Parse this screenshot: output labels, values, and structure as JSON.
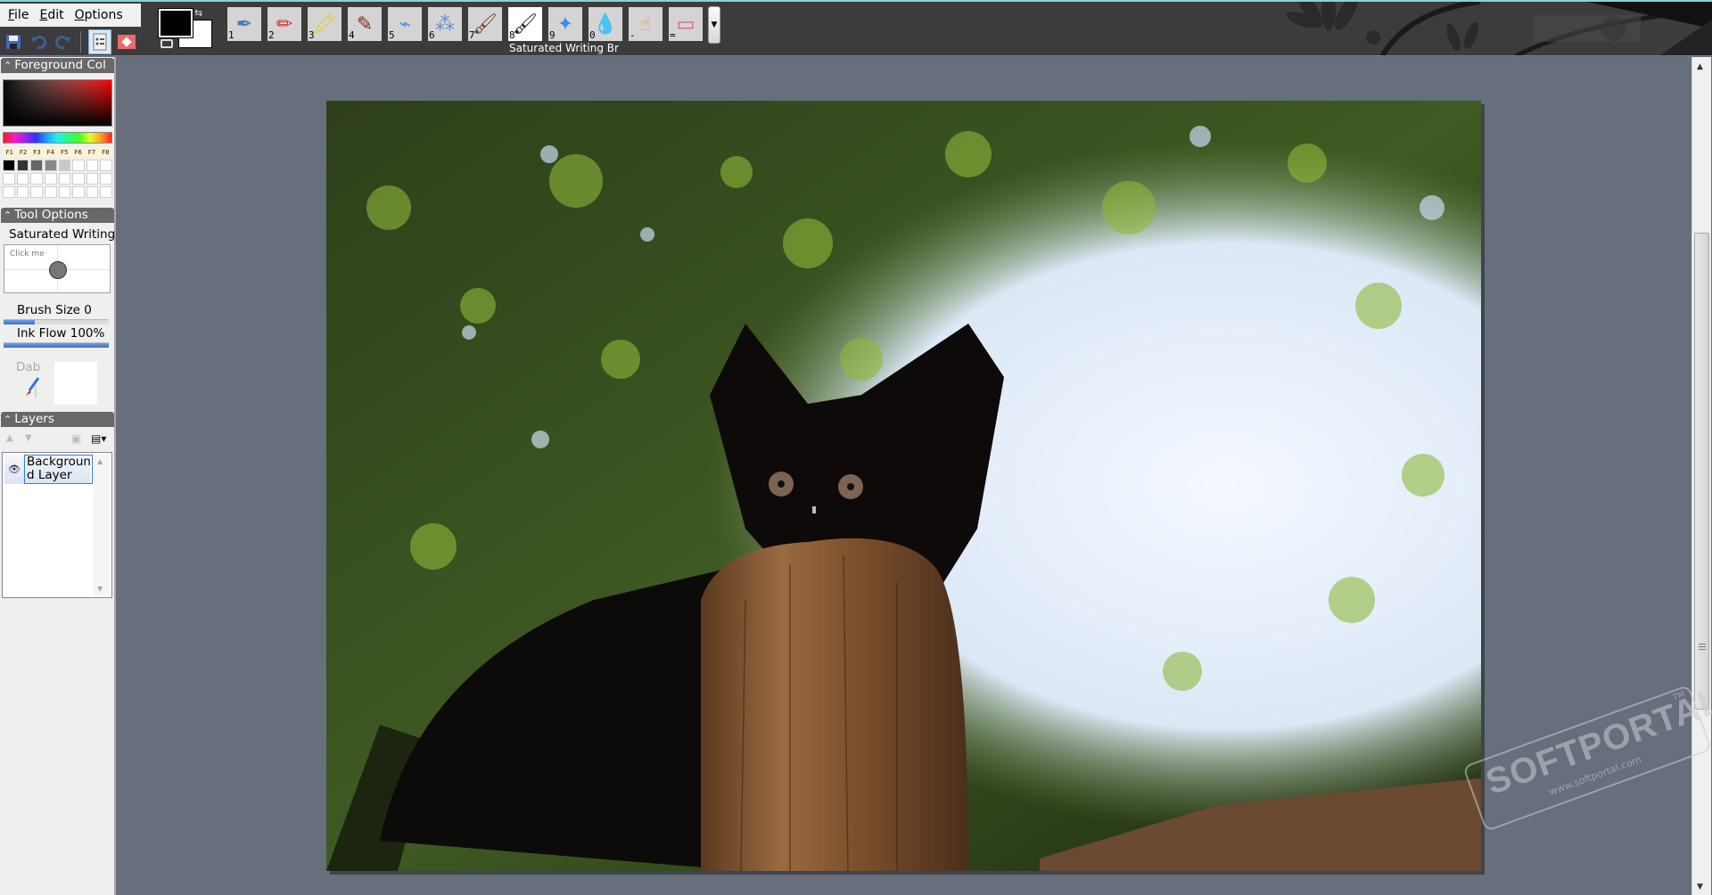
{
  "menu": {
    "items": [
      {
        "label": "File",
        "accel": "F",
        "rest": "ile"
      },
      {
        "label": "Edit",
        "accel": "E",
        "rest": "dit"
      },
      {
        "label": "Options",
        "accel": "O",
        "rest": "ptions"
      }
    ]
  },
  "quickbar": {
    "items": [
      {
        "name": "save-icon",
        "glyph": "💾",
        "enabled": true
      },
      {
        "name": "undo-icon",
        "glyph": "↶",
        "enabled": false
      },
      {
        "name": "redo-icon",
        "glyph": "↷",
        "enabled": false
      },
      {
        "name": "document-properties-icon",
        "glyph": "▤",
        "active": true
      },
      {
        "name": "record-icon",
        "glyph": "◆"
      }
    ]
  },
  "colors": {
    "foreground": "#000000",
    "background": "#ffffff",
    "header_bg": "#3c3c3c",
    "canvas_bg": "#676e7c",
    "accent_line": "#8fd0d0"
  },
  "brushes": {
    "selected_index": 7,
    "selected_name": "Saturated Writing Br",
    "items": [
      {
        "key": "1",
        "name": "pen",
        "icon": "✒"
      },
      {
        "key": "2",
        "name": "pencil",
        "icon": "✏"
      },
      {
        "key": "3",
        "name": "highlighter",
        "icon": "🖍"
      },
      {
        "key": "4",
        "name": "crayon",
        "icon": "✎"
      },
      {
        "key": "5",
        "name": "airbrush",
        "icon": "⌁"
      },
      {
        "key": "6",
        "name": "spray",
        "icon": "⁂"
      },
      {
        "key": "7",
        "name": "paintbrush",
        "icon": "🖌"
      },
      {
        "key": "8",
        "name": "saturated-writing-brush",
        "icon": "🖌"
      },
      {
        "key": "9",
        "name": "sparkle",
        "icon": "✦"
      },
      {
        "key": "0",
        "name": "water-drop",
        "icon": "💧"
      },
      {
        "key": "-",
        "name": "smudge-finger",
        "icon": "☝"
      },
      {
        "key": "=",
        "name": "eraser",
        "icon": "▭"
      }
    ]
  },
  "panels": {
    "foreground": {
      "title": "Foreground Col",
      "fkeys": [
        "F1",
        "F2",
        "F3",
        "F4",
        "F5",
        "F6",
        "F7",
        "F8"
      ],
      "palette": [
        "#000000",
        "#333333",
        "#666666",
        "#888888",
        "#c8c8c8",
        "#ffffff",
        "#ffffff",
        "#ffffff",
        "#ffffff",
        "#ffffff",
        "#ffffff",
        "#ffffff",
        "#ffffff",
        "#ffffff",
        "#ffffff",
        "#ffffff",
        "#ffffff",
        "#ffffff",
        "#ffffff",
        "#ffffff",
        "#ffffff",
        "#ffffff",
        "#ffffff",
        "#ffffff"
      ]
    },
    "tool_options": {
      "title": "Tool Options",
      "tool_name": "Saturated Writing",
      "preview_hint": "Click me",
      "brush_size_label": "Brush Size 0",
      "brush_size_fraction": 0.3,
      "ink_flow_label": "Ink Flow  100%",
      "ink_flow_fraction": 1.0,
      "dab_label": "Dab"
    },
    "layers": {
      "title": "Layers",
      "items": [
        {
          "name": "Background Layer",
          "visible": true,
          "selected": true
        }
      ]
    }
  },
  "watermark": {
    "text": "SOFTPORTAL",
    "url": "www.softportal.com",
    "tm": "TM"
  }
}
